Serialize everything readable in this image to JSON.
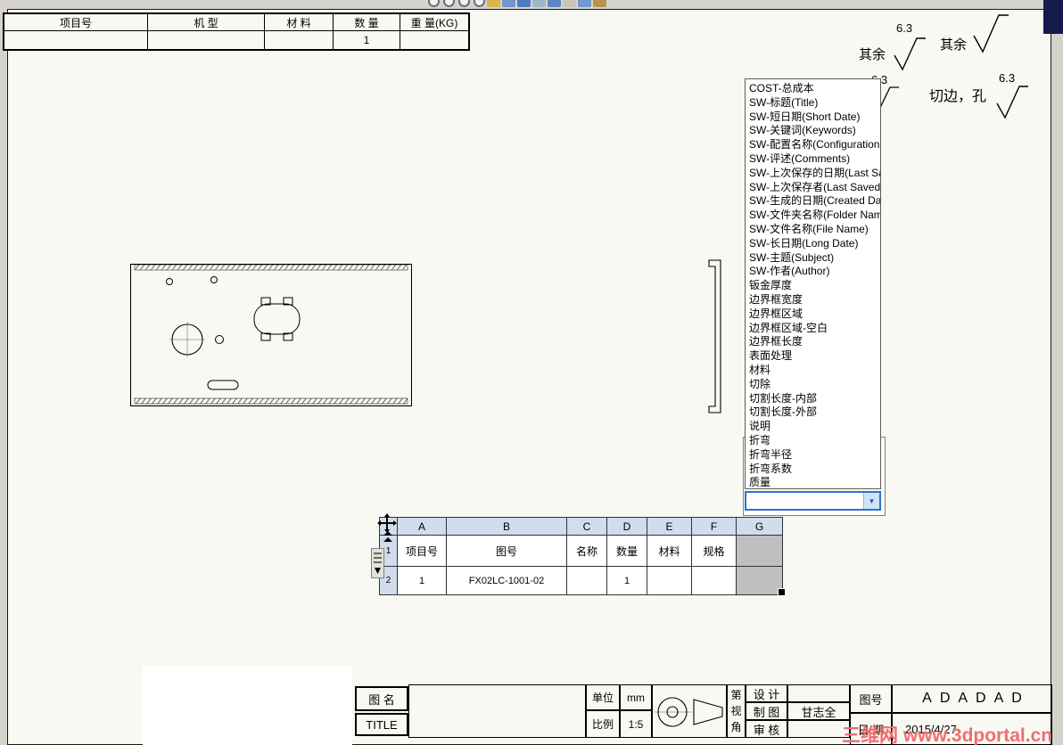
{
  "toolbar_icons": [
    "zoom-to-fit-icon",
    "zoom-to-area-icon",
    "zoom-in-out-icon",
    "rotate-view-icon",
    "pan-icon",
    "view-orientation-icon",
    "display-style-icon",
    "hide-show-items-icon",
    "edit-appearance-icon",
    "apply-scene-icon",
    "view-settings-icon",
    "camera-icon"
  ],
  "top_table": {
    "headers": [
      "项目号",
      "机 型",
      "材 料",
      "数 量",
      "重 量(KG)"
    ],
    "quantity": "1"
  },
  "surface_marks": {
    "others_1_label": "其余",
    "others_1_value": "6.3",
    "others_2_label": "其余",
    "hidden_value": "6.3",
    "cut_label": "切边，孔",
    "cut_value": "6.3"
  },
  "property_list": {
    "items": [
      "COST-总成本",
      "SW-标题(Title)",
      "SW-短日期(Short Date)",
      "SW-关键词(Keywords)",
      "SW-配置名称(Configuration Name)",
      "SW-评述(Comments)",
      "SW-上次保存的日期(Last Saved Date)",
      "SW-上次保存者(Last Saved By)",
      "SW-生成的日期(Created Date)",
      "SW-文件夹名称(Folder Name)",
      "SW-文件名称(File Name)",
      "SW-长日期(Long Date)",
      "SW-主题(Subject)",
      "SW-作者(Author)",
      "钣金厚度",
      "边界框宽度",
      "边界框区域",
      "边界框区域-空白",
      "边界框长度",
      "表面处理",
      "材料",
      "切除",
      "切割长度-内部",
      "切割长度-外部",
      "说明",
      "折弯",
      "折弯半径",
      "折弯系数",
      "质量"
    ],
    "combo_value": ""
  },
  "bom_table": {
    "columns": [
      "A",
      "B",
      "C",
      "D",
      "E",
      "F",
      "G"
    ],
    "row_numbers": [
      "1",
      "2"
    ],
    "header_row": [
      "项目号",
      "图号",
      "名称",
      "数量",
      "材料",
      "规格",
      ""
    ],
    "data_row": [
      "1",
      "FX02LC-1001-02",
      "",
      "1",
      "",
      "",
      ""
    ]
  },
  "title_block": {
    "name_label": "图 名",
    "title_label": "TITLE",
    "unit_label": "单位",
    "unit_value": "mm",
    "scale_label": "比例",
    "scale_value": "1:5",
    "angle_chars": [
      "第",
      "视",
      "角"
    ],
    "design_label": "设 计",
    "draft_label": "制 图",
    "check_label": "审 核",
    "draft_value": "甘志全",
    "drawing_no_label": "图号",
    "drawing_no_value": "ADADAD",
    "date_label": "日 期",
    "date_value": "2015/4/27"
  },
  "watermark": "三维网 www.3dportal.cn"
}
